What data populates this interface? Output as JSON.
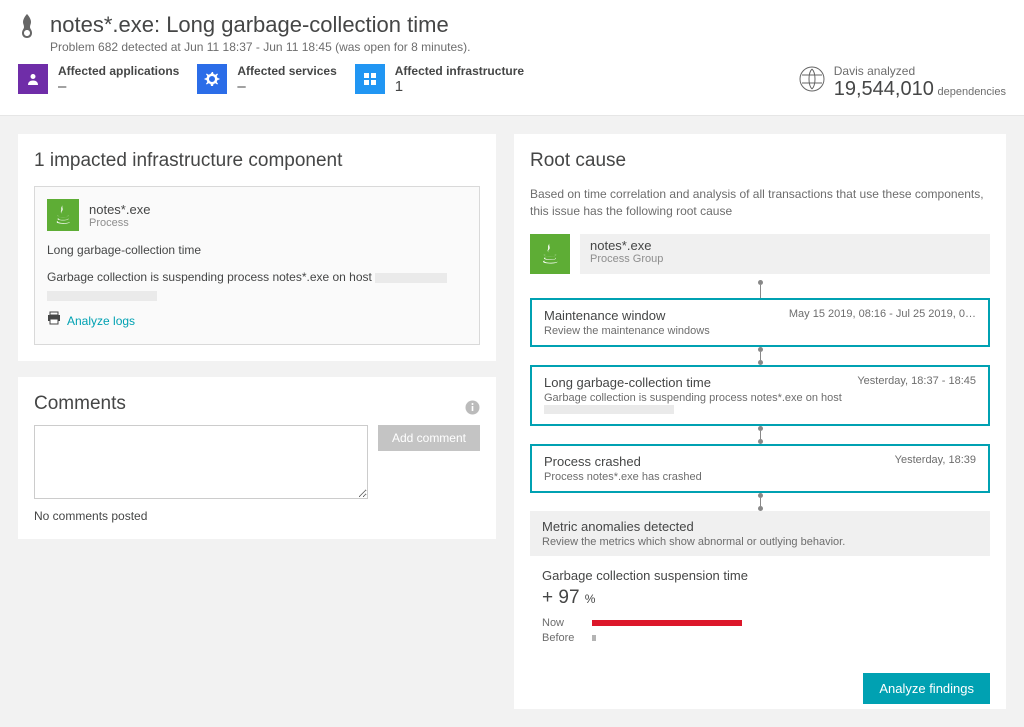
{
  "header": {
    "title": "notes*.exe: Long garbage-collection time",
    "subtitle": "Problem 682 detected at Jun 11 18:37 - Jun 11 18:45 (was open for 8 minutes).",
    "metrics": {
      "apps": {
        "label": "Affected applications",
        "value": "–"
      },
      "services": {
        "label": "Affected services",
        "value": "–"
      },
      "infra": {
        "label": "Affected infrastructure",
        "value": "1"
      }
    },
    "davis": {
      "label": "Davis analyzed",
      "number": "19,544,010",
      "suffix": "dependencies"
    }
  },
  "impacted": {
    "title": "1 impacted infrastructure component",
    "entity": {
      "name": "notes*.exe",
      "type": "Process"
    },
    "problem_title": "Long garbage-collection time",
    "problem_desc": "Garbage collection is suspending process notes*.exe on host ",
    "analyze_logs": "Analyze logs"
  },
  "comments": {
    "title": "Comments",
    "add_label": "Add comment",
    "placeholder": "",
    "empty": "No comments posted"
  },
  "root_cause": {
    "title": "Root cause",
    "subtitle": "Based on time correlation and analysis of all transactions that use these components, this issue has the following root cause",
    "entity": {
      "name": "notes*.exe",
      "type": "Process Group"
    },
    "events": [
      {
        "title": "Maintenance window",
        "desc": "Review the maintenance windows",
        "time": "May 15 2019, 08:16 - Jul 25 2019, 0…"
      },
      {
        "title": "Long garbage-collection time",
        "desc": "Garbage collection is suspending process notes*.exe on host ",
        "time": "Yesterday, 18:37 - 18:45",
        "redacted": true
      },
      {
        "title": "Process crashed",
        "desc": "Process notes*.exe has crashed",
        "time": "Yesterday, 18:39"
      }
    ],
    "anomalies": {
      "title": "Metric anomalies detected",
      "subtitle": "Review the metrics which show abnormal or outlying behavior.",
      "metric_name": "Garbage collection suspension time",
      "change": "+ 97",
      "pct": "%",
      "now_label": "Now",
      "before_label": "Before"
    },
    "analyze_button": "Analyze findings"
  }
}
